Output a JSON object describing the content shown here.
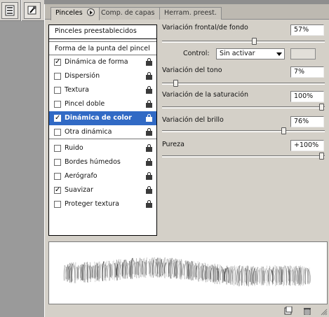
{
  "tabs": [
    {
      "label": "Pinceles",
      "active": true
    },
    {
      "label": "Comp. de capas",
      "active": false
    },
    {
      "label": "Herram. preest.",
      "active": false
    }
  ],
  "presets_label": "Pinceles preestablecidos",
  "tip_shape_label": "Forma de la punta del pincel",
  "options": [
    {
      "label": "Dinámica de forma",
      "checked": true,
      "selected": false
    },
    {
      "label": "Dispersión",
      "checked": false,
      "selected": false
    },
    {
      "label": "Textura",
      "checked": false,
      "selected": false
    },
    {
      "label": "Pincel doble",
      "checked": false,
      "selected": false
    },
    {
      "label": "Dinámica de color",
      "checked": true,
      "selected": true
    },
    {
      "label": "Otra dinámica",
      "checked": false,
      "selected": false
    },
    {
      "label": "Ruido",
      "checked": false,
      "selected": false
    },
    {
      "label": "Bordes húmedos",
      "checked": false,
      "selected": false
    },
    {
      "label": "Aerógrafo",
      "checked": false,
      "selected": false
    },
    {
      "label": "Suavizar",
      "checked": true,
      "selected": false
    },
    {
      "label": "Proteger textura",
      "checked": false,
      "selected": false
    }
  ],
  "controls": {
    "fg_bg": {
      "label": "Variación frontal/de fondo",
      "value": "57%",
      "level": 0.57
    },
    "control": {
      "label": "Control:",
      "value": "Sin activar"
    },
    "hue": {
      "label": "Variación del tono",
      "value": "7%",
      "level": 0.07
    },
    "saturation": {
      "label": "Variación de la saturación",
      "value": "100%",
      "level": 1.0
    },
    "brightness": {
      "label": "Variación del brillo",
      "value": "76%",
      "level": 0.76
    },
    "purity": {
      "label": "Pureza",
      "value": "+100%",
      "level": 1.0
    }
  },
  "colors": {
    "selection": "#316ac5",
    "panel": "#d4d0c8",
    "background": "#8e8e8e"
  },
  "icons": {
    "dock_1": "palette-icon",
    "dock_2": "tool-presets-icon",
    "new_brush": "new-brush-icon",
    "delete": "trash-icon"
  }
}
